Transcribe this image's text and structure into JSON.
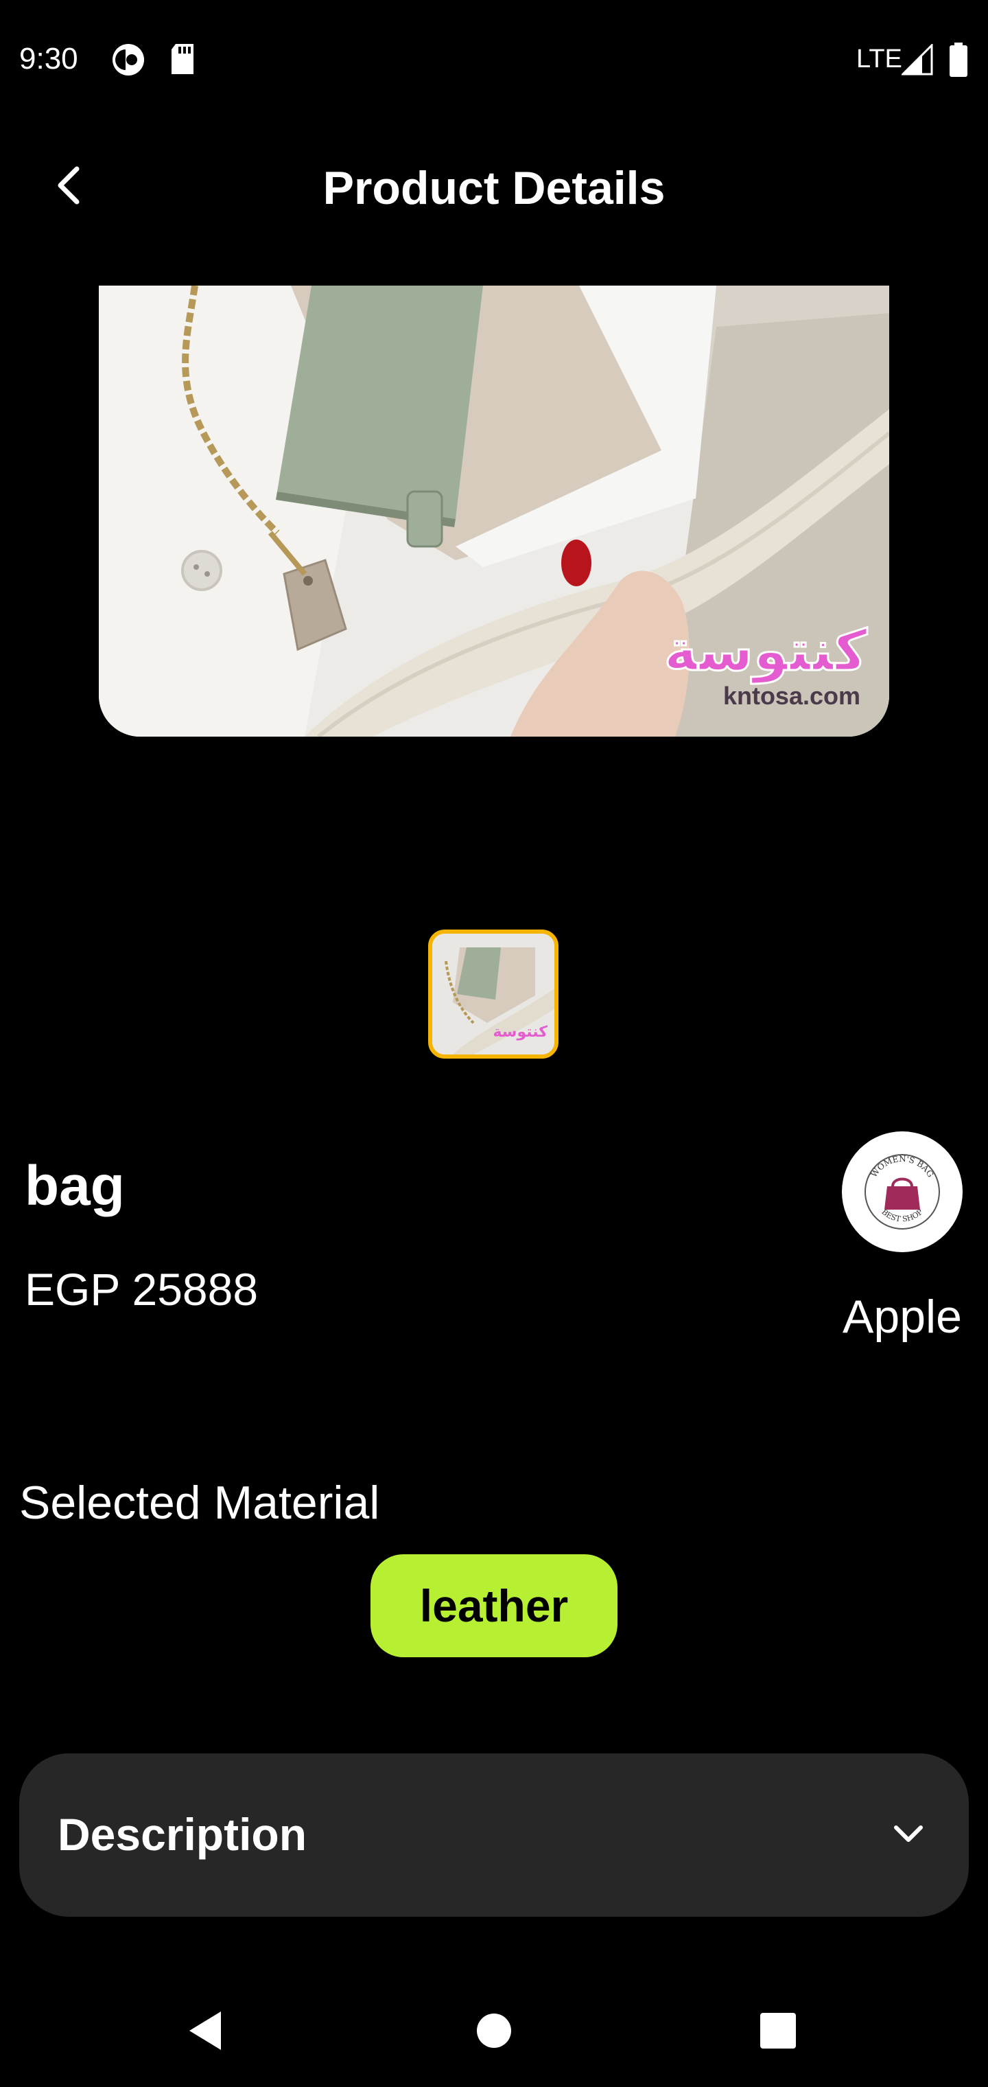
{
  "status_bar": {
    "time": "9:30",
    "network": "LTE",
    "icons": [
      "privacy-dot-icon",
      "sd-card-icon",
      "signal-icon",
      "battery-icon"
    ]
  },
  "app_bar": {
    "title": "Product Details",
    "back_icon": "chevron-left-icon"
  },
  "gallery": {
    "main_image": "handbag-photo",
    "watermark_arabic": "كنتوسة",
    "watermark_domain": "kntosa.com",
    "thumbnails": [
      "handbag-photo"
    ],
    "selected_thumbnail": 0,
    "selected_color": "#f5b400"
  },
  "product": {
    "name": "bag",
    "price": "EGP 25888",
    "brand": {
      "name": "Apple",
      "logo_top_text": "WOMEN'S BAG",
      "logo_bottom_text": "BEST SHOP"
    }
  },
  "material": {
    "label": "Selected Material",
    "value": "leather",
    "chip_color": "#b7f033"
  },
  "description": {
    "title": "Description",
    "toggle_icon": "chevron-down-icon"
  },
  "nav_bar": {
    "buttons": [
      "back-triangle-icon",
      "home-circle-icon",
      "recents-square-icon"
    ]
  }
}
